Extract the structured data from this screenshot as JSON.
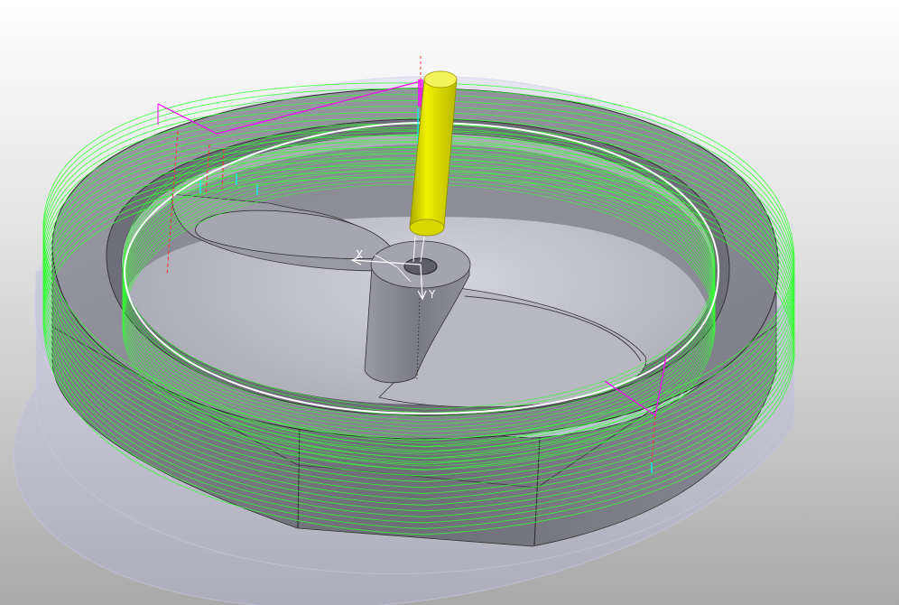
{
  "viewport": {
    "background_top": "#ffffff",
    "background_bottom": "#a9a9a9"
  },
  "model": {
    "part_color": "#8a8a94",
    "part_light": "#c0c0c8",
    "stock_color": "#b4b4dc",
    "toolpath_color": "#33ff33",
    "tool_color": "#e6e600",
    "linking_move_color": "#ff00ff",
    "rapid_move_color": "#ff3333",
    "plunge_move_color": "#00ffff",
    "toolpath_pass_count": 17
  },
  "csys": {
    "x_label": "X",
    "y_label": "Y"
  }
}
